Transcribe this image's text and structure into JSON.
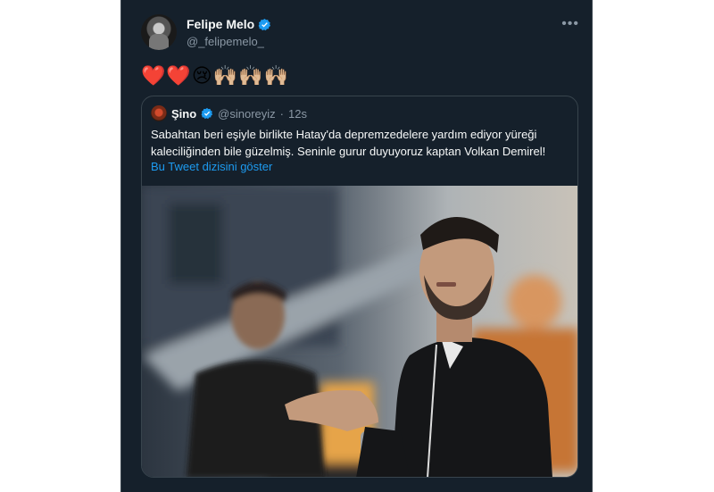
{
  "tweet": {
    "author_name": "Felipe Melo",
    "author_handle": "@_felipemelo_",
    "more_icon": "more-icon",
    "emojis": "❤️❤️😢🙌🏼🙌🏼🙌🏼"
  },
  "quoted": {
    "name": "Şino",
    "handle": "@sinoreyiz",
    "dot": "·",
    "time": "12s",
    "text": "Sabahtan beri eşiyle birlikte Hatay'da depremzedelere yardım ediyor yüreği kaleciliğinden bile güzelmiş. Seninle gurur duyuyoruz kaptan Volkan Demirel!",
    "thread_link": "Bu Tweet dizisini göster"
  },
  "colors": {
    "background": "#15202b",
    "border": "#38444d",
    "text": "#f7f9f9",
    "muted": "#8b98a5",
    "accent": "#1d9bf0"
  }
}
